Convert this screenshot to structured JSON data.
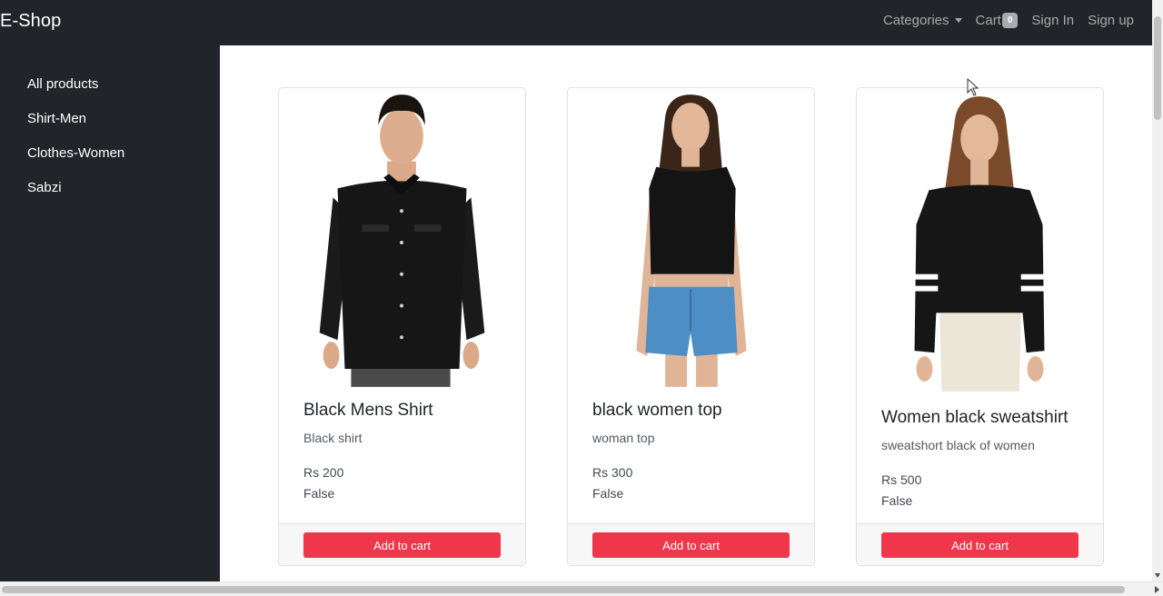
{
  "navbar": {
    "brand": "E-Shop",
    "categories_label": "Categories",
    "cart_label": "Cart",
    "cart_count": "0",
    "signin_label": "Sign In",
    "signup_label": "Sign up"
  },
  "sidebar": {
    "items": [
      {
        "label": "All products"
      },
      {
        "label": "Shirt-Men"
      },
      {
        "label": "Clothes-Women"
      },
      {
        "label": "Sabzi"
      }
    ]
  },
  "products": [
    {
      "title": "Black Mens Shirt",
      "description": "Black shirt",
      "price": "Rs 200",
      "stock": "False",
      "button_label": "Add to cart",
      "image_icon": "man-shirt-photo"
    },
    {
      "title": "black women top",
      "description": "woman top",
      "price": "Rs 300",
      "stock": "False",
      "button_label": "Add to cart",
      "image_icon": "woman-top-photo"
    },
    {
      "title": "Women black sweatshirt",
      "description": "sweatshort black of women",
      "price": "Rs 500",
      "stock": "False",
      "button_label": "Add to cart",
      "image_icon": "woman-sweatshirt-photo"
    }
  ],
  "colors": {
    "navbar_bg": "#212529",
    "button_bg": "#f0364a"
  }
}
